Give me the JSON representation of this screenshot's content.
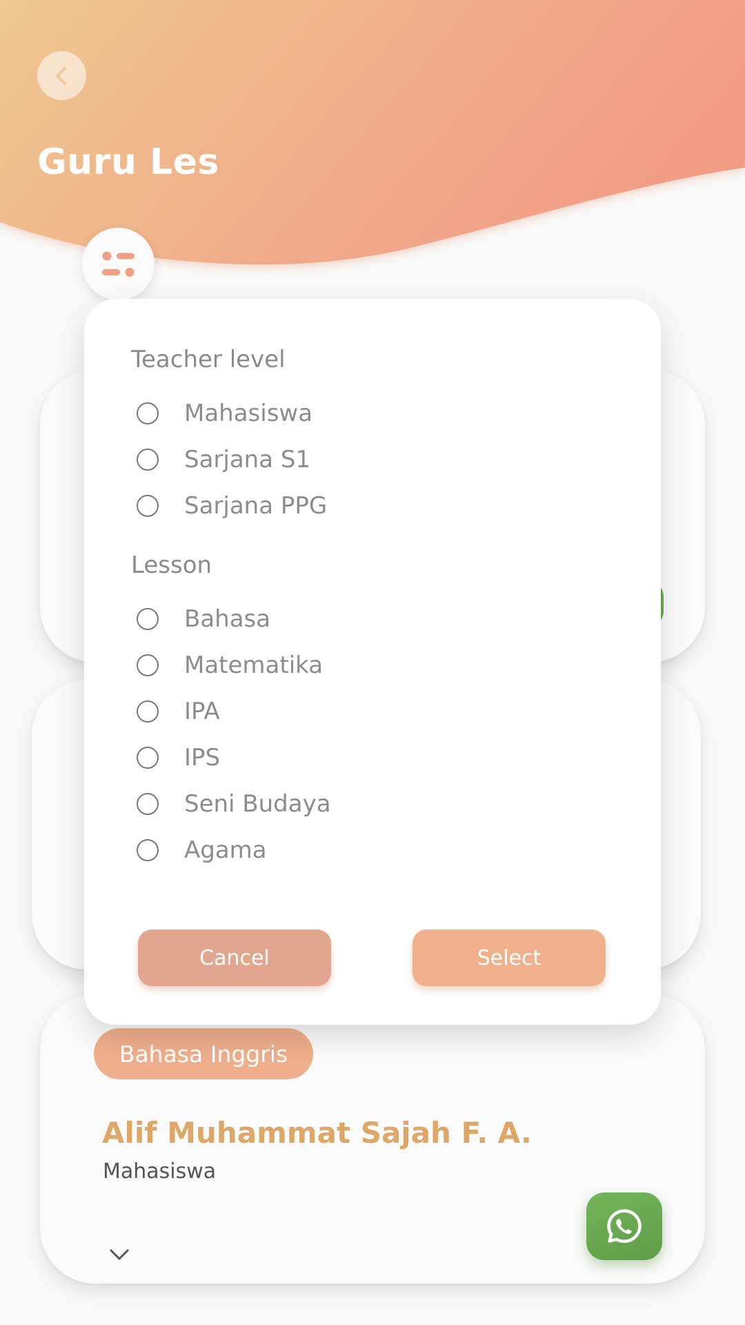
{
  "header": {
    "title": "Guru Les",
    "gradient_start": "#f0c891",
    "gradient_end": "#f29c86"
  },
  "icons": {
    "back": "chevron-left-icon",
    "filter": "filter-sliders-icon",
    "expand": "chevron-down-icon",
    "whatsapp": "whatsapp-icon"
  },
  "filter_dialog": {
    "teacher_level": {
      "title": "Teacher level",
      "options": [
        "Mahasiswa",
        "Sarjana S1",
        "Sarjana PPG"
      ]
    },
    "lesson": {
      "title": "Lesson",
      "options": [
        "Bahasa",
        "Matematika",
        "IPA",
        "IPS",
        "Seni Budaya",
        "Agama"
      ]
    },
    "cancel_label": "Cancel",
    "select_label": "Select"
  },
  "teacher_card": {
    "subject": "Bahasa Inggris",
    "name": "Alif Muhammat Sajah F. A.",
    "level": "Mahasiswa"
  },
  "colors": {
    "accent_orange": "#efae8c",
    "cancel": "#e2a690",
    "name_gold": "#dda767",
    "whatsapp_green": "#6aaa52"
  }
}
